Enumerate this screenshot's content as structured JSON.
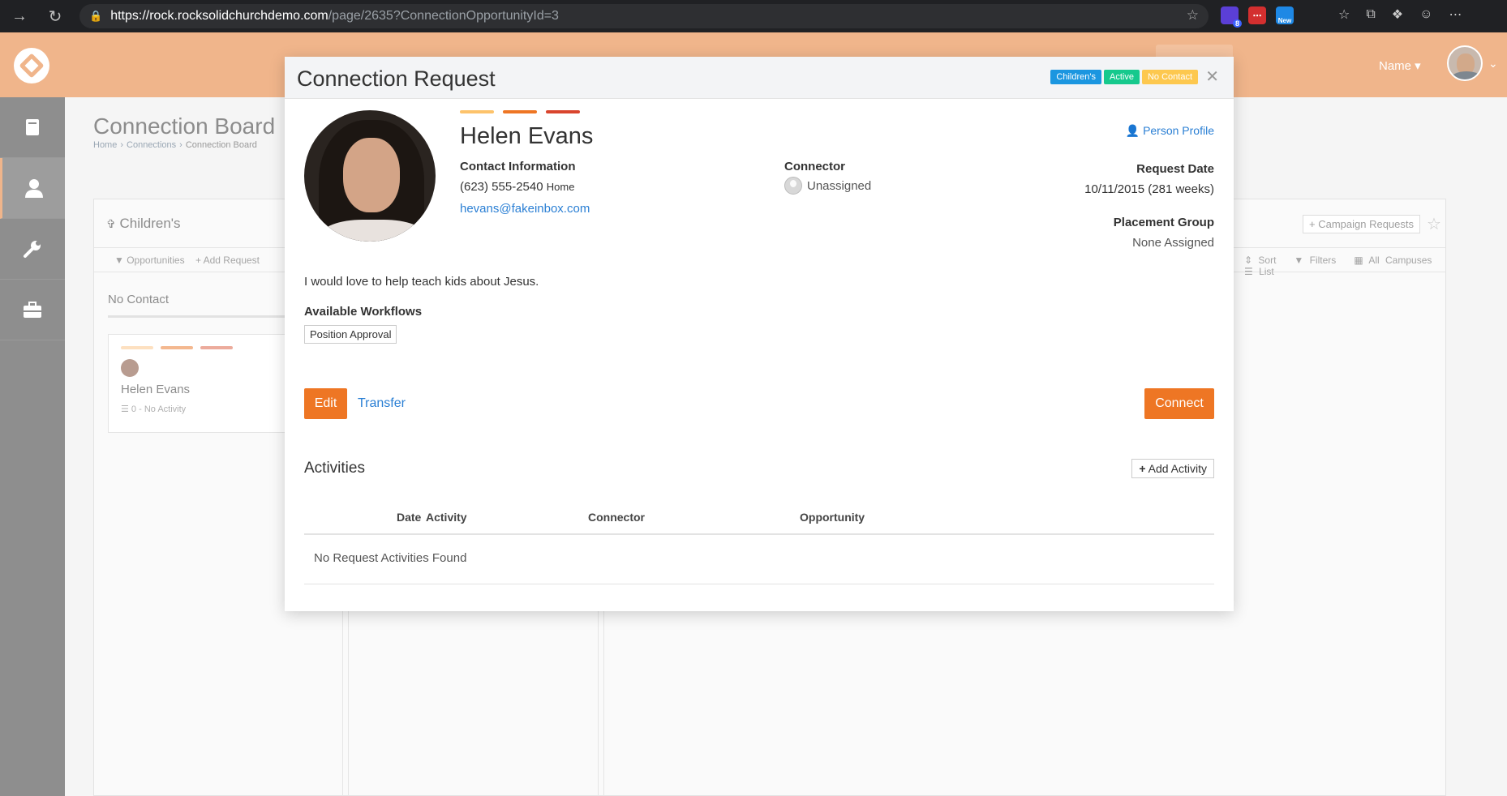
{
  "browser": {
    "url_host": "https://rock.rocksolidchurchdemo.com",
    "url_path": "/page/2635?ConnectionOpportunityId=3",
    "ext_badge_count": "8",
    "ext_new_label": "New"
  },
  "header": {
    "user_name": "Name"
  },
  "page": {
    "title": "Connection Board",
    "breadcrumb": [
      "Home",
      "Connections",
      "Connection Board"
    ],
    "opportunity_name": "Children's",
    "campaign_button": "Campaign Requests",
    "toolbar_left": [
      "Opportunities",
      "Add Request"
    ],
    "toolbar_right": [
      "Sort",
      "Filters",
      "All Campuses",
      "List"
    ],
    "column_label": "No Contact",
    "card": {
      "name": "Helen Evans",
      "meta": "0 - No Activity"
    }
  },
  "modal": {
    "title": "Connection Request",
    "badges": [
      {
        "label": "Children's",
        "color": "#1b96e0"
      },
      {
        "label": "Active",
        "color": "#16c98d"
      },
      {
        "label": "No Contact",
        "color": "#fdc84f"
      }
    ],
    "status_bar_colors": [
      "#fdc36b",
      "#ee7624",
      "#d9452d"
    ],
    "person_name": "Helen Evans",
    "person_profile_link": "Person Profile",
    "contact_label": "Contact Information",
    "phone": "(623) 555-2540",
    "phone_type": "Home",
    "email": "hevans@fakeinbox.com",
    "connector_label": "Connector",
    "connector_value": "Unassigned",
    "request_date_label": "Request Date",
    "request_date_value": "10/11/2015 (281 weeks)",
    "placement_group_label": "Placement Group",
    "placement_group_value": "None Assigned",
    "comment": "I would love to help teach kids about Jesus.",
    "workflows_label": "Available Workflows",
    "workflow_button": "Position Approval",
    "edit_label": "Edit",
    "transfer_label": "Transfer",
    "connect_label": "Connect",
    "activities_title": "Activities",
    "add_activity_label": "Add Activity",
    "table_headers": [
      "Date",
      "Activity",
      "Connector",
      "Opportunity"
    ],
    "empty_message": "No Request Activities Found"
  }
}
